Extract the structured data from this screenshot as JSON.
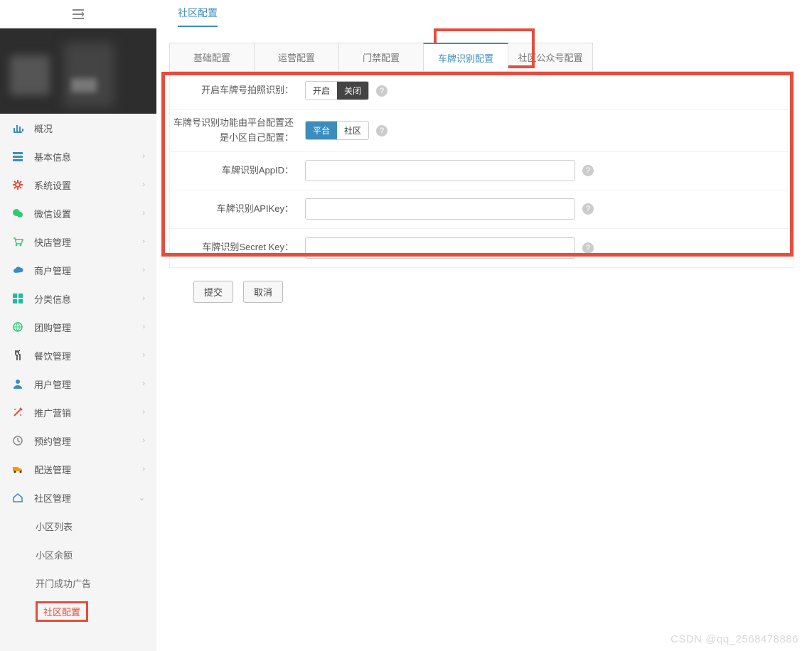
{
  "breadcrumb": {
    "title": "社区配置"
  },
  "sidebar": {
    "items": [
      {
        "label": "概况",
        "icon": "chart",
        "color": "#3c8dbc",
        "expandable": false
      },
      {
        "label": "基本信息",
        "icon": "list",
        "color": "#3c8dbc",
        "expandable": true
      },
      {
        "label": "系统设置",
        "icon": "gear",
        "color": "#e74c3c",
        "expandable": true
      },
      {
        "label": "微信设置",
        "icon": "wechat",
        "color": "#2ecc71",
        "expandable": true
      },
      {
        "label": "快店管理",
        "icon": "cart",
        "color": "#2ecc71",
        "expandable": true
      },
      {
        "label": "商户管理",
        "icon": "cloud",
        "color": "#3c8dbc",
        "expandable": true
      },
      {
        "label": "分类信息",
        "icon": "grid",
        "color": "#1abc9c",
        "expandable": true
      },
      {
        "label": "团购管理",
        "icon": "globe",
        "color": "#2ecc71",
        "expandable": true
      },
      {
        "label": "餐饮管理",
        "icon": "fork",
        "color": "#333",
        "expandable": true
      },
      {
        "label": "用户管理",
        "icon": "user",
        "color": "#3c8dbc",
        "expandable": true
      },
      {
        "label": "推广营销",
        "icon": "wand",
        "color": "#e74c3c",
        "expandable": true
      },
      {
        "label": "预约管理",
        "icon": "clock",
        "color": "#888",
        "expandable": true
      },
      {
        "label": "配送管理",
        "icon": "truck",
        "color": "#f39c12",
        "expandable": true
      },
      {
        "label": "社区管理",
        "icon": "home",
        "color": "#3c8dbc",
        "expandable": true,
        "expanded": true
      }
    ],
    "subitems": [
      {
        "label": "小区列表"
      },
      {
        "label": "小区余额"
      },
      {
        "label": "开门成功广告"
      },
      {
        "label": "社区配置",
        "active": true
      }
    ]
  },
  "tabs": [
    {
      "label": "基础配置"
    },
    {
      "label": "运营配置"
    },
    {
      "label": "门禁配置"
    },
    {
      "label": "车牌识别配置",
      "active": true
    },
    {
      "label": "社区公众号配置"
    }
  ],
  "form": {
    "row1": {
      "label": "开启车牌号拍照识别：",
      "opt_on": "开启",
      "opt_off": "关闭",
      "selected": "off"
    },
    "row2": {
      "label": "车牌号识别功能由平台配置还是小区自己配置：",
      "opt_a": "平台",
      "opt_b": "社区",
      "selected": "a"
    },
    "row3": {
      "label": "车牌识别AppID：",
      "value": ""
    },
    "row4": {
      "label": "车牌识别APIKey：",
      "value": ""
    },
    "row5": {
      "label": "车牌识别Secret Key：",
      "value": ""
    }
  },
  "actions": {
    "submit": "提交",
    "cancel": "取消"
  },
  "watermark": "CSDN @qq_2568478886"
}
